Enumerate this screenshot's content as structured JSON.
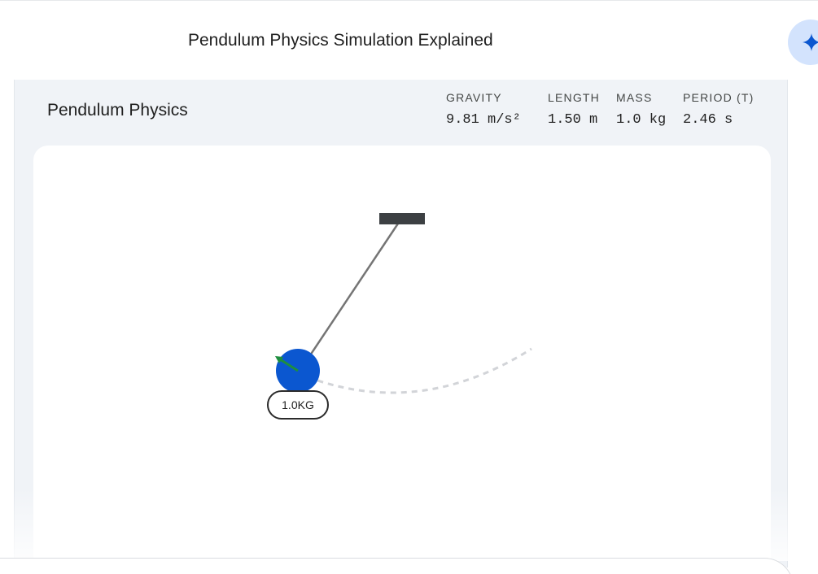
{
  "header": {
    "title": "Pendulum Physics Simulation Explained",
    "assist_icon": "sparkle-icon"
  },
  "panel": {
    "title": "Pendulum Physics",
    "stats": {
      "gravity": {
        "label": "GRAVITY",
        "value": "9.81 m/s²"
      },
      "length": {
        "label": "LENGTH",
        "value": "1.50 m"
      },
      "mass": {
        "label": "MASS",
        "value": "1.0 kg"
      },
      "period": {
        "label": "PERIOD (T)",
        "value": "2.46 s"
      }
    }
  },
  "simulation": {
    "bob_label": "1.0KG",
    "colors": {
      "bob": "#0b57d0",
      "rod": "#757575",
      "pivot": "#3c4043",
      "arc": "#d2d4d8",
      "velocity": "#1e8e3e"
    }
  }
}
